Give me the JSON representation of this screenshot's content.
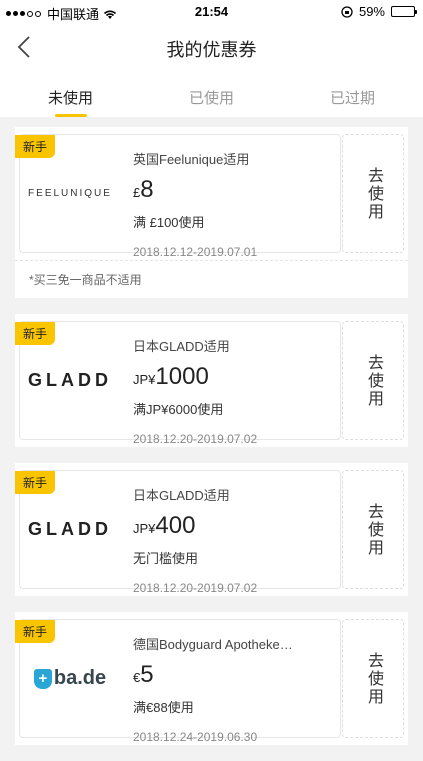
{
  "status": {
    "carrier": "中国联通",
    "time": "21:54",
    "battery": "59%",
    "battery_level": 0.59
  },
  "nav": {
    "title": "我的优惠券"
  },
  "tabs": [
    {
      "label": "未使用"
    },
    {
      "label": "已使用"
    },
    {
      "label": "已过期"
    }
  ],
  "coupons": [
    {
      "badge": "新手",
      "brand": "FEELUNIQUE",
      "scope": "英国Feelunique适用",
      "currency": "£",
      "value": "8",
      "condition": "满 £100使用",
      "date": "2018.12.12-2019.07.01",
      "action": "去使用",
      "note": "*买三免一商品不适用"
    },
    {
      "badge": "新手",
      "brand": "GLADD",
      "scope": "日本GLADD适用",
      "currency": "JP¥",
      "value": "1000",
      "condition": "满JP¥6000使用",
      "date": "2018.12.20-2019.07.02",
      "action": "去使用"
    },
    {
      "badge": "新手",
      "brand": "GLADD",
      "scope": "日本GLADD适用",
      "currency": "JP¥",
      "value": "400",
      "condition": "无门槛使用",
      "date": "2018.12.20-2019.07.02",
      "action": "去使用"
    },
    {
      "badge": "新手",
      "brand": "ba.de",
      "scope": "德国Bodyguard Apotheke…",
      "currency": "€",
      "value": "5",
      "condition": "满€88使用",
      "date": "2018.12.24-2019.06.30",
      "action": "去使用"
    }
  ]
}
